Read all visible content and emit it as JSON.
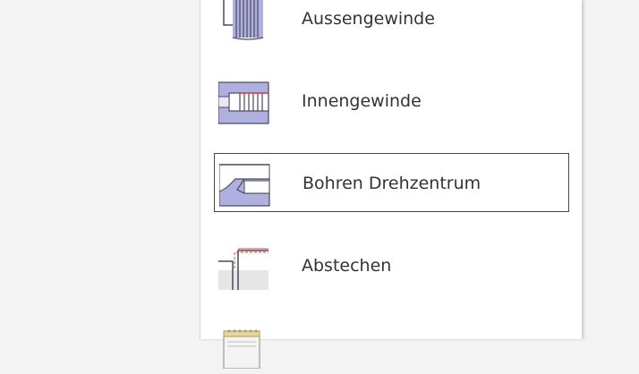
{
  "menu": {
    "items": [
      {
        "label": "Aussengewinde",
        "icon": "external-thread-icon",
        "selected": false
      },
      {
        "label": "Innengewinde",
        "icon": "internal-thread-icon",
        "selected": false
      },
      {
        "label": "Bohren Drehzentrum",
        "icon": "drill-center-icon",
        "selected": true
      },
      {
        "label": "Abstechen",
        "icon": "part-off-icon",
        "selected": false
      },
      {
        "label": "",
        "icon": "notepad-icon",
        "selected": false
      }
    ]
  },
  "colors": {
    "icon_fill": "#b0b0e0",
    "icon_stroke": "#4a4a5a",
    "accent_red": "#e04040",
    "selection_border": "#3c4a55"
  }
}
